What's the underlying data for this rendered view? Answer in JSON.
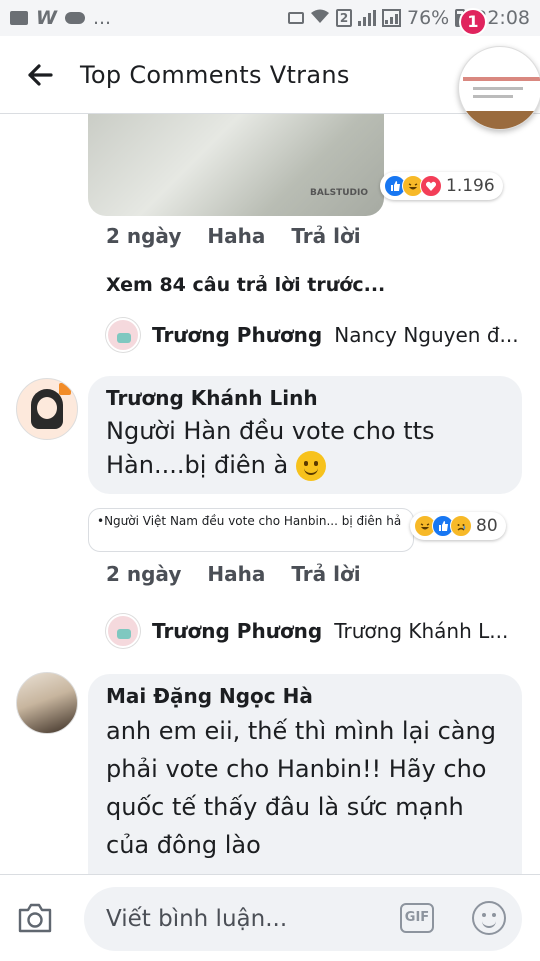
{
  "status_bar": {
    "battery": "76%",
    "time": "22:08",
    "sim": "2",
    "more": "..."
  },
  "header": {
    "title": "Top Comments Vtrans",
    "back_icon": "arrow-left-icon",
    "chathead_badge": "1"
  },
  "post_photo": {
    "label": "BALSTUDIO"
  },
  "comment1": {
    "reactions": [
      "like",
      "haha",
      "love"
    ],
    "reaction_count": "1.196",
    "time": "2 ngày",
    "action_haha": "Haha",
    "action_reply": "Trả lời",
    "view_previous": "Xem 84 câu trả lời trước...",
    "reply_name": "Trương Phương",
    "reply_preview": "Nancy Nguyen đ..."
  },
  "comment2": {
    "name": "Trương Khánh Linh",
    "text": "Người Hàn đều vote cho tts Hàn....bị điên à",
    "translation": "•Người Việt Nam đều vote cho Hanbin... bị điên hả",
    "reactions": [
      "haha",
      "like",
      "sad"
    ],
    "reaction_count": "80",
    "time": "2 ngày",
    "action_haha": "Haha",
    "action_reply": "Trả lời",
    "reply_name": "Trương Phương",
    "reply_preview": "Trương Khánh L..."
  },
  "comment3": {
    "name": "Mai Đặng Ngọc Hà",
    "text": "anh em eii, thế thì mình lại càng phải vote cho Hanbin!! Hãy cho quốc tế thấy đâu là sức mạnh của đông lào"
  },
  "composer": {
    "placeholder": "Viết bình luận...",
    "gif_label": "GIF",
    "camera_icon": "camera-icon",
    "emoji_icon": "emoji-icon"
  },
  "colors": {
    "like": "#1877f2",
    "love": "#f33e58",
    "haha": "#f7b928",
    "badge": "#e0245e",
    "bubble": "#f0f2f5"
  }
}
